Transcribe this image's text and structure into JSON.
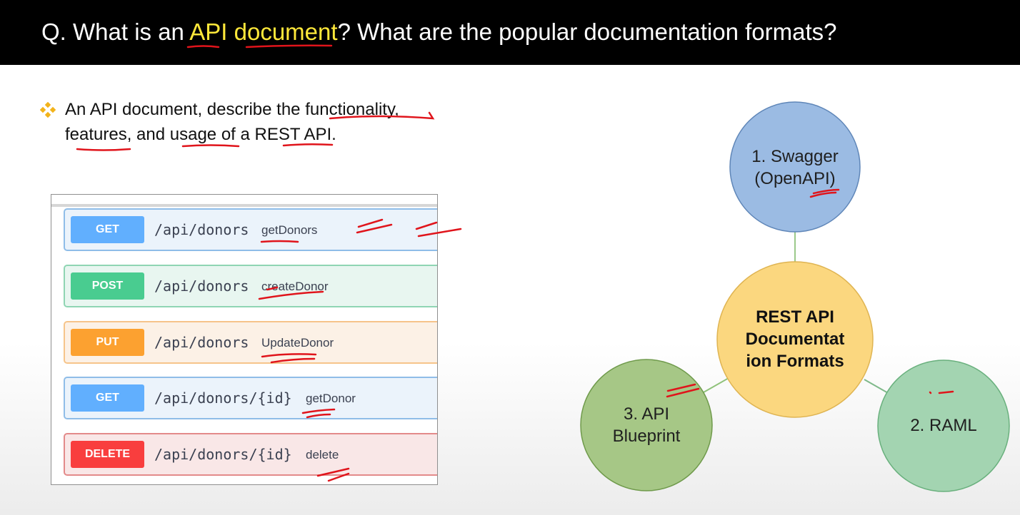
{
  "header": {
    "prefix": "Q. What is an ",
    "highlight1": "API",
    "space": " ",
    "highlight2": "document",
    "suffix": "? What are the popular documentation formats?"
  },
  "bullet": {
    "icon": "diamond-bullet-icon",
    "text": "An API document, describe the functionality, features, and usage of a REST API."
  },
  "swagger_panel": {
    "operations": [
      {
        "method": "GET",
        "path": "/api/donors",
        "name": "getDonors"
      },
      {
        "method": "POST",
        "path": "/api/donors",
        "name": "createDonor"
      },
      {
        "method": "PUT",
        "path": "/api/donors",
        "name": "UpdateDonor"
      },
      {
        "method": "GET",
        "path": "/api/donors/{id}",
        "name": "getDonor"
      },
      {
        "method": "DELETE",
        "path": "/api/donors/{id}",
        "name": "delete"
      }
    ]
  },
  "diagram": {
    "center_line1": "REST API",
    "center_line2": "Documentat",
    "center_line3": "ion Formats",
    "swagger_line1": "1. Swagger",
    "swagger_line2": "(OpenAPI)",
    "raml": "2. RAML",
    "blueprint_line1": "3. API",
    "blueprint_line2": "Blueprint"
  },
  "colors": {
    "header_bg": "#000000",
    "highlight": "#ffe83a",
    "get": "#61affe",
    "post": "#49cc90",
    "put": "#fca130",
    "delete": "#f93e3e",
    "center_circle": "#fbd77f",
    "swagger_circle": "#9bbbe3",
    "raml_circle": "#a3d4b1",
    "blueprint_circle": "#a6c786",
    "annotation_ink": "#e0141b"
  }
}
